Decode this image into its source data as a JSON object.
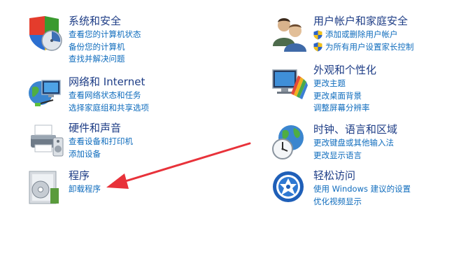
{
  "categories": {
    "system": {
      "title": "系统和安全",
      "links": [
        "查看您的计算机状态",
        "备份您的计算机",
        "查找并解决问题"
      ]
    },
    "network": {
      "title": "网络和 Internet",
      "links": [
        "查看网络状态和任务",
        "选择家庭组和共享选项"
      ]
    },
    "hardware": {
      "title": "硬件和声音",
      "links": [
        "查看设备和打印机",
        "添加设备"
      ]
    },
    "programs": {
      "title": "程序",
      "links": [
        "卸载程序"
      ]
    },
    "users": {
      "title": "用户帐户和家庭安全",
      "links": [
        "添加或删除用户帐户",
        "为所有用户设置家长控制"
      ]
    },
    "appearance": {
      "title": "外观和个性化",
      "links": [
        "更改主题",
        "更改桌面背景",
        "调整屏幕分辨率"
      ]
    },
    "clock": {
      "title": "时钟、语言和区域",
      "links": [
        "更改键盘或其他输入法",
        "更改显示语言"
      ]
    },
    "ease": {
      "title": "轻松访问",
      "links": [
        "使用 Windows 建议的设置",
        "优化视频显示"
      ]
    }
  },
  "annotation": {
    "arrow_color": "#e8323a"
  }
}
